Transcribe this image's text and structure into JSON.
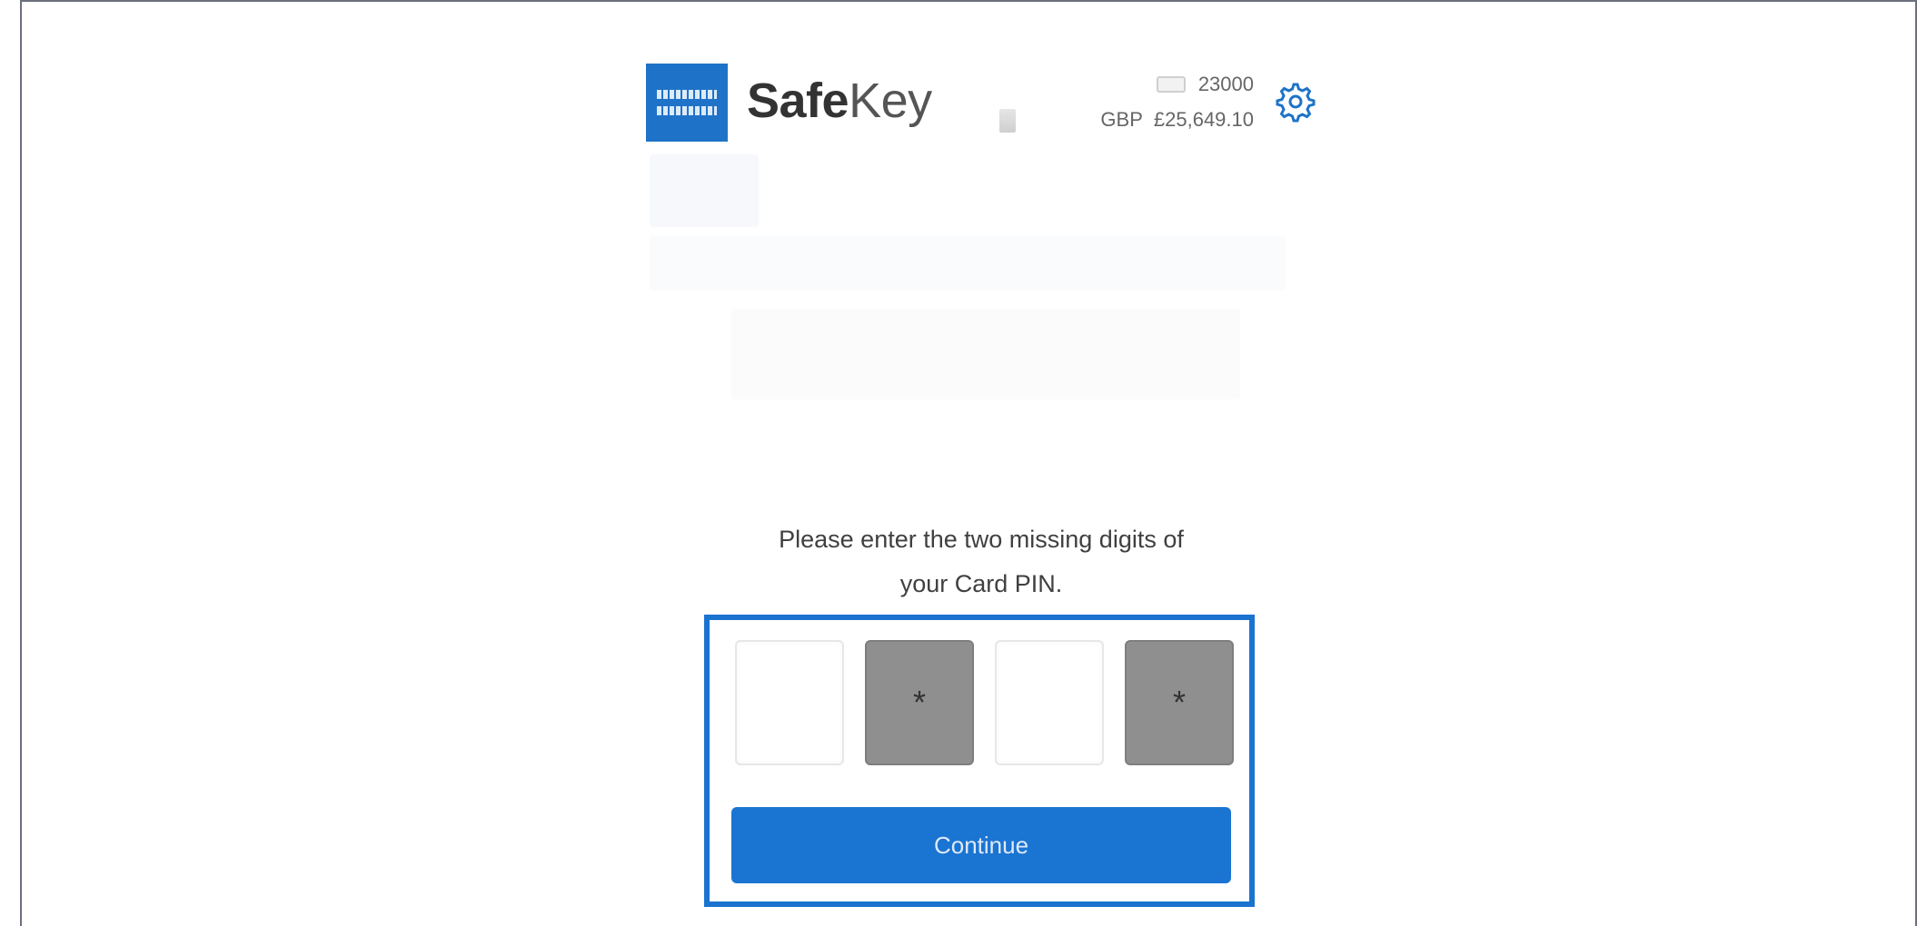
{
  "brand": {
    "name_bold": "Safe",
    "name_regular": "Key"
  },
  "account": {
    "points": "23000",
    "currency": "GBP",
    "balance": "£25,649.10"
  },
  "prompt": {
    "line1": "Please enter the two missing digits of",
    "line2": "your Card PIN."
  },
  "pin": {
    "boxes": [
      {
        "state": "empty",
        "value": ""
      },
      {
        "state": "filled",
        "value": "*"
      },
      {
        "state": "empty",
        "value": ""
      },
      {
        "state": "filled",
        "value": "*"
      }
    ]
  },
  "continue_label": "Continue",
  "colors": {
    "accent": "#1a74d2",
    "highlight": "#1a73cf",
    "logo": "#1e73c8"
  },
  "icons": {
    "settings": "gear-icon",
    "logo": "amex-logo-icon"
  }
}
